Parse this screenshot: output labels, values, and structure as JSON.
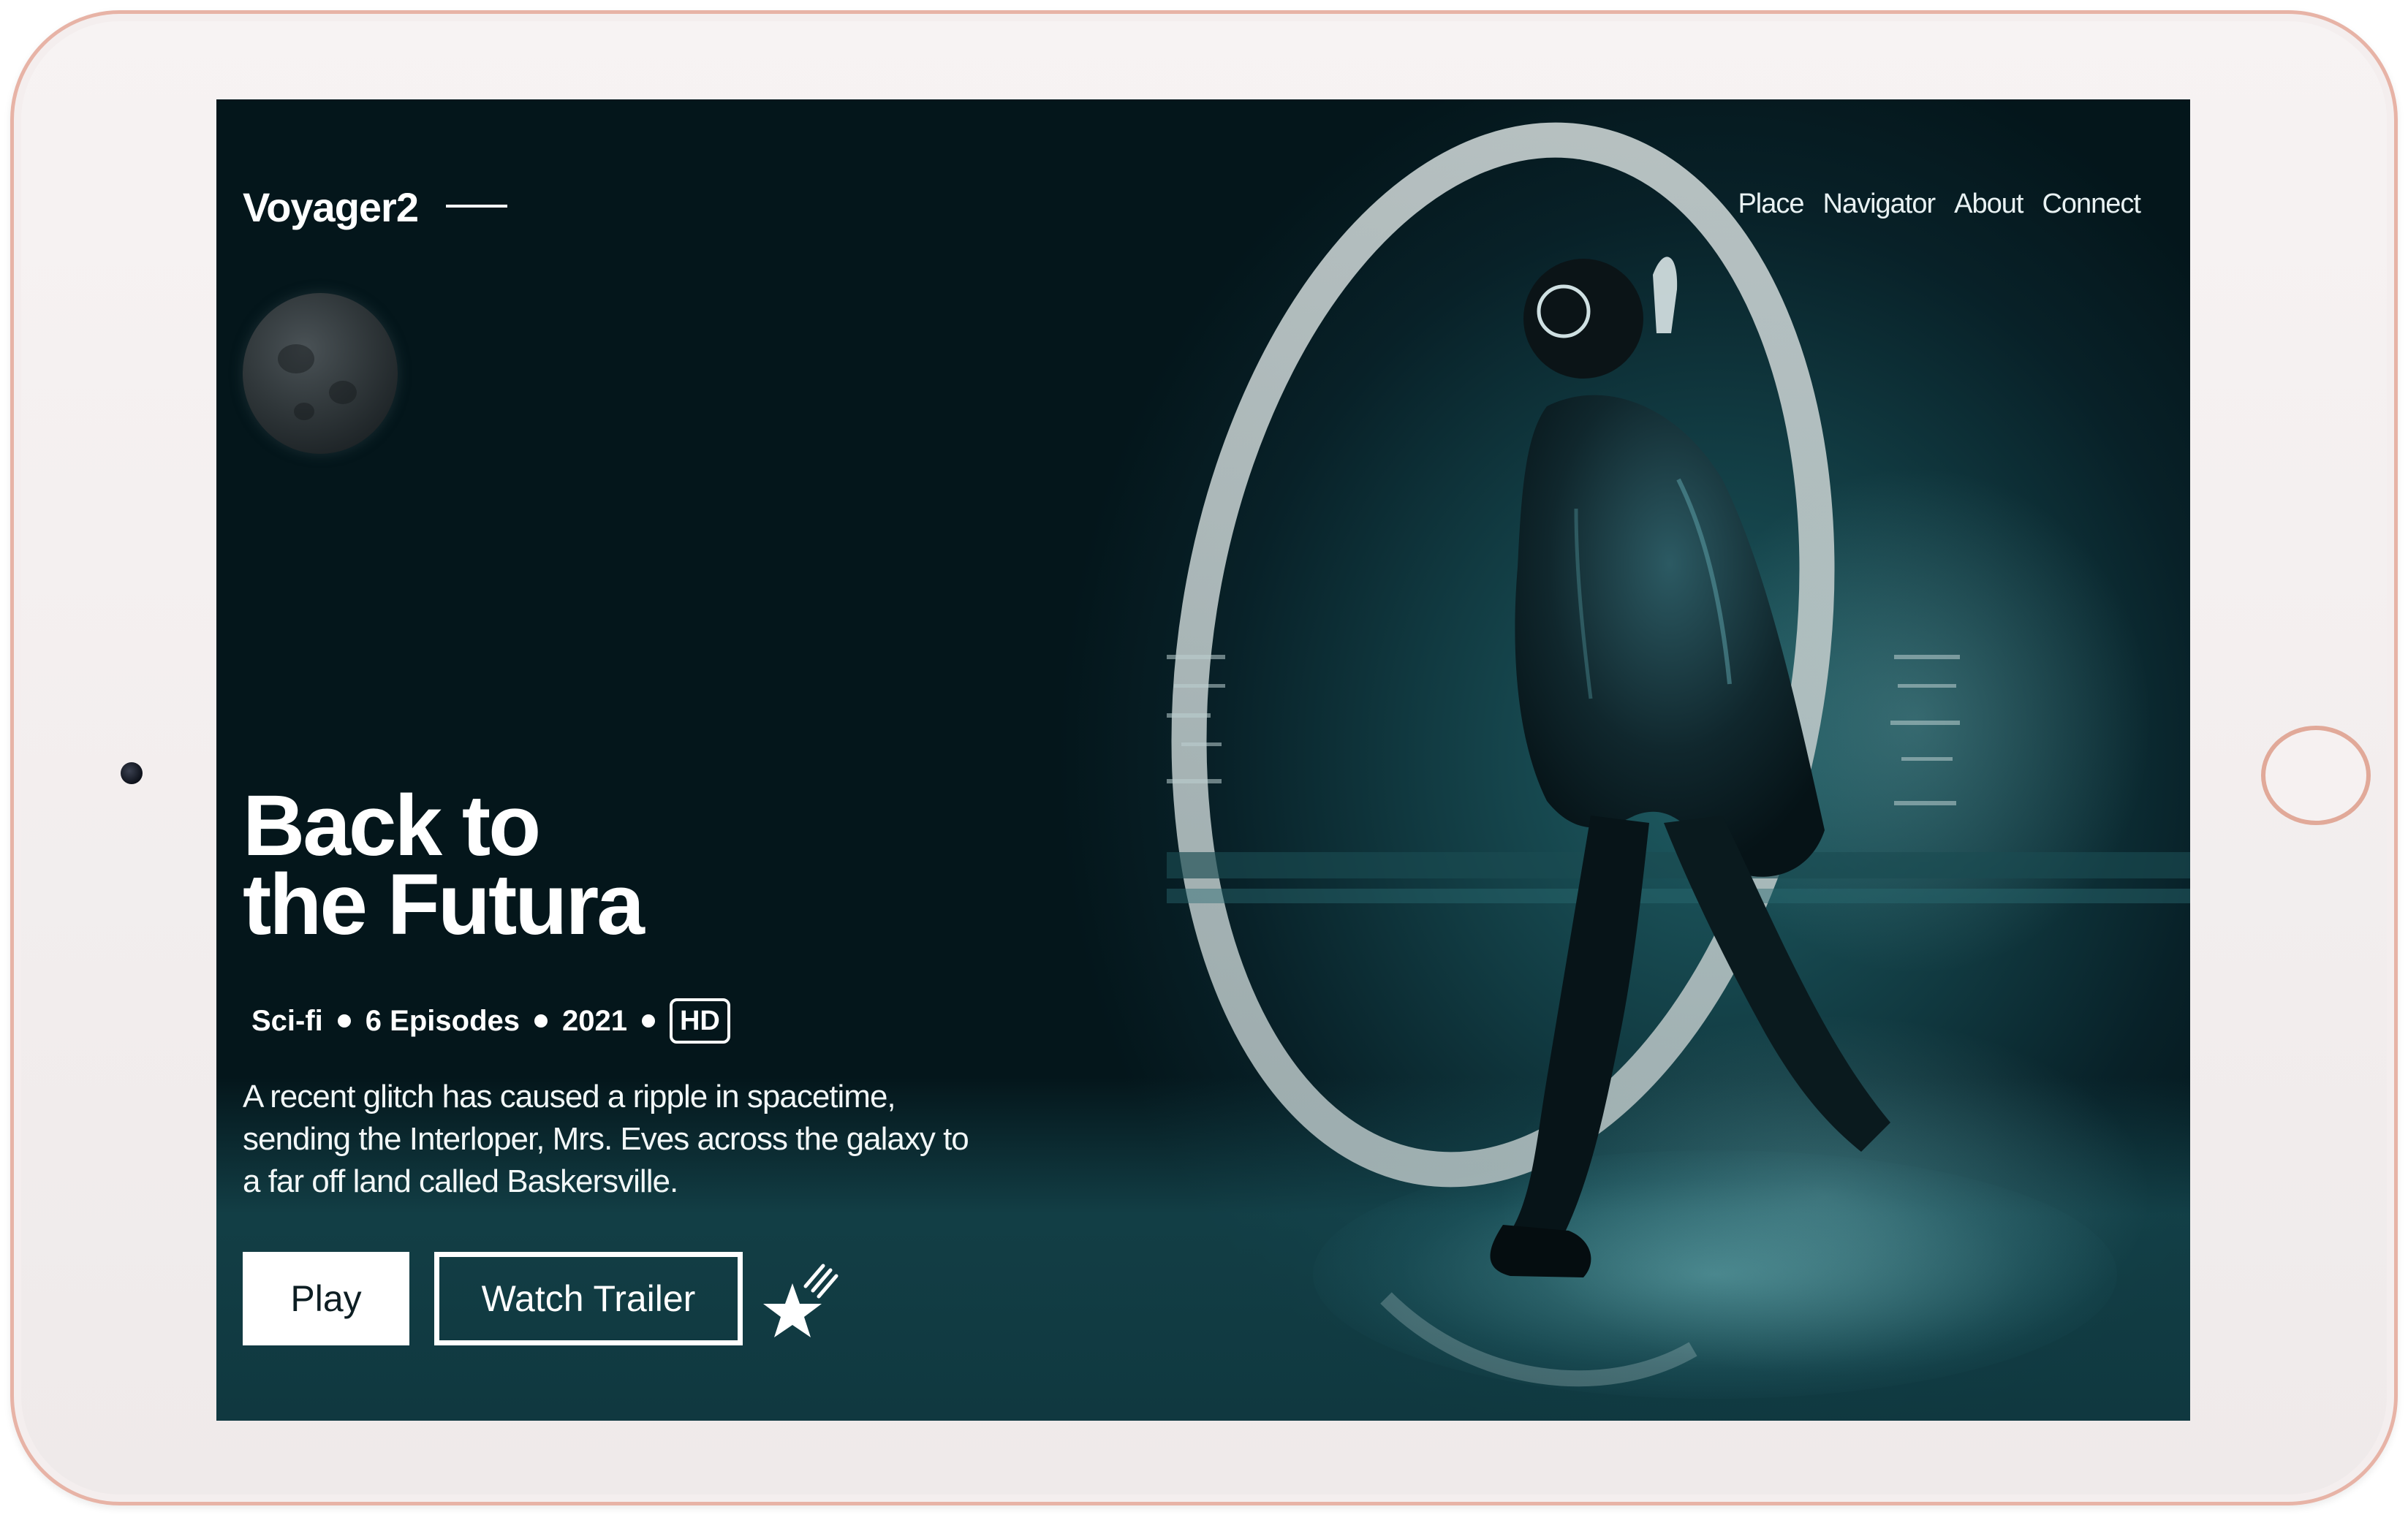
{
  "app": {
    "logo": "Voyager2"
  },
  "nav": {
    "items": [
      "Place",
      "Navigator",
      "About",
      "Connect"
    ]
  },
  "hero": {
    "title_line1": "Back to",
    "title_line2": "the Futura",
    "genre": "Sci-fi",
    "episodes": "6 Episodes",
    "year": "2021",
    "quality_badge": "HD",
    "description": "A recent glitch has caused a ripple in spacetime, sending the Interloper, Mrs. Eves across the galaxy to a far off land called Baskersville."
  },
  "actions": {
    "play_label": "Play",
    "trailer_label": "Watch Trailer",
    "favorite_icon": "star-icon"
  },
  "colors": {
    "background_dark": "#04161b",
    "background_teal": "#1f5d64",
    "frame_rose_gold": "#e7b3a6",
    "text_primary": "#ffffff"
  },
  "icons": {
    "camera": "camera-dot",
    "home_button": "home-button",
    "moon": "moon-image",
    "figure": "astronaut-illustration"
  }
}
